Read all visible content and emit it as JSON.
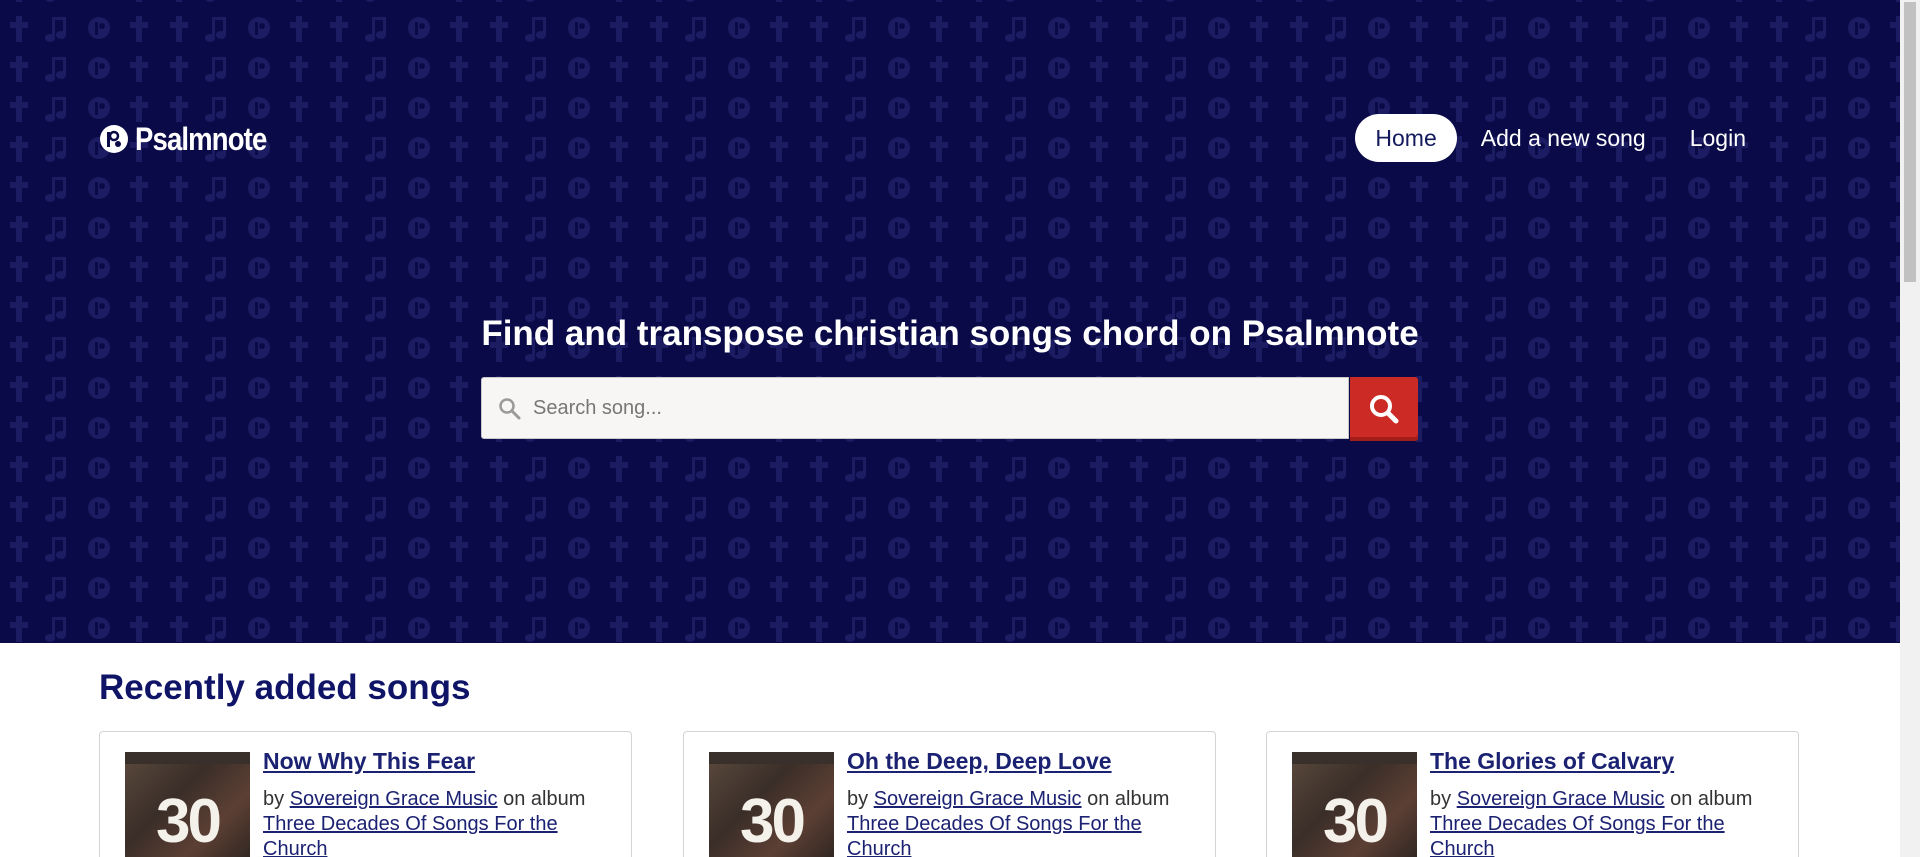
{
  "header": {
    "brand_name": "Psalmnote",
    "nav": [
      {
        "label": "Home",
        "active": true
      },
      {
        "label": "Add a new song",
        "active": false
      },
      {
        "label": "Login",
        "active": false
      }
    ]
  },
  "hero": {
    "title": "Find and transpose christian songs chord on Psalmnote",
    "search_placeholder": "Search song..."
  },
  "recent": {
    "title": "Recently added songs",
    "by_label": "by",
    "on_album_label": "on album",
    "songs": [
      {
        "title": "Now Why This Fear",
        "artist": "Sovereign Grace Music",
        "album": "Three Decades Of Songs For the Church",
        "cover_text": "30"
      },
      {
        "title": "Oh the Deep, Deep Love",
        "artist": "Sovereign Grace Music",
        "album": "Three Decades Of Songs For the Church",
        "cover_text": "30"
      },
      {
        "title": "The Glories of Calvary",
        "artist": "Sovereign Grace Music",
        "album": "Three Decades Of Songs For the Church",
        "cover_text": "30"
      }
    ]
  },
  "colors": {
    "hero_bg": "#0a0a48",
    "accent_red": "#cc2a25",
    "heading_navy": "#0f1466"
  }
}
